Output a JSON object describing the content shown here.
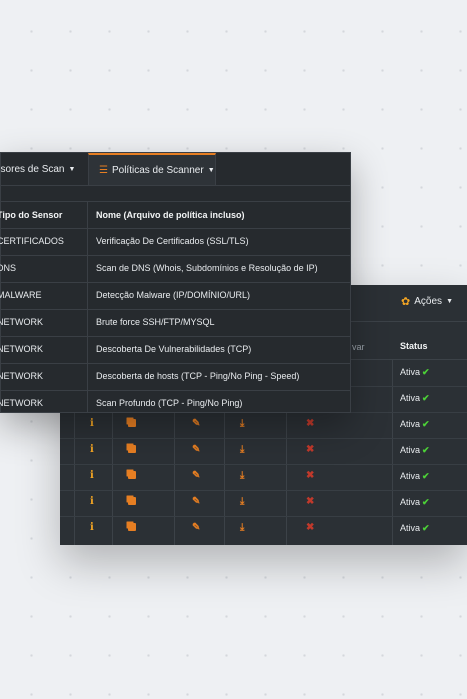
{
  "back_panel": {
    "actions_label": "Ações",
    "header_var": "var",
    "header_status": "Status",
    "rows": [
      {
        "status": "Ativa"
      },
      {
        "status": "Ativa"
      },
      {
        "status": "Ativa"
      },
      {
        "status": "Ativa"
      },
      {
        "status": "Ativa"
      },
      {
        "status": "Ativa"
      },
      {
        "status": "Ativa"
      }
    ],
    "check": "✔"
  },
  "front_panel": {
    "tabs": [
      {
        "label": "nsores de Scan"
      },
      {
        "label": "Políticas de Scanner"
      }
    ],
    "headers": {
      "col1": "Tipo do Sensor",
      "col2": "Nome (Arquivo de política incluso)"
    },
    "rows": [
      {
        "sensor": "CERTIFICADOS",
        "name": "Verificação De Certificados (SSL/TLS)"
      },
      {
        "sensor": "DNS",
        "name": "Scan de DNS (Whois, Subdomínios e Resolução de IP)"
      },
      {
        "sensor": "MALWARE",
        "name": "Detecção Malware (IP/DOMÍNIO/URL)"
      },
      {
        "sensor": "NETWORK",
        "name": "Brute force SSH/FTP/MYSQL"
      },
      {
        "sensor": "NETWORK",
        "name": "Descoberta De Vulnerabilidades (TCP)"
      },
      {
        "sensor": "NETWORK",
        "name": "Descoberta de hosts (TCP - Ping/No Ping - Speed)"
      },
      {
        "sensor": "NETWORK",
        "name": "Scan Profundo (TCP - Ping/No Ping)"
      }
    ]
  },
  "colors": {
    "accent": "#e67e22",
    "panel": "#262a2e",
    "success": "#4cd137",
    "danger": "#c0392b"
  }
}
